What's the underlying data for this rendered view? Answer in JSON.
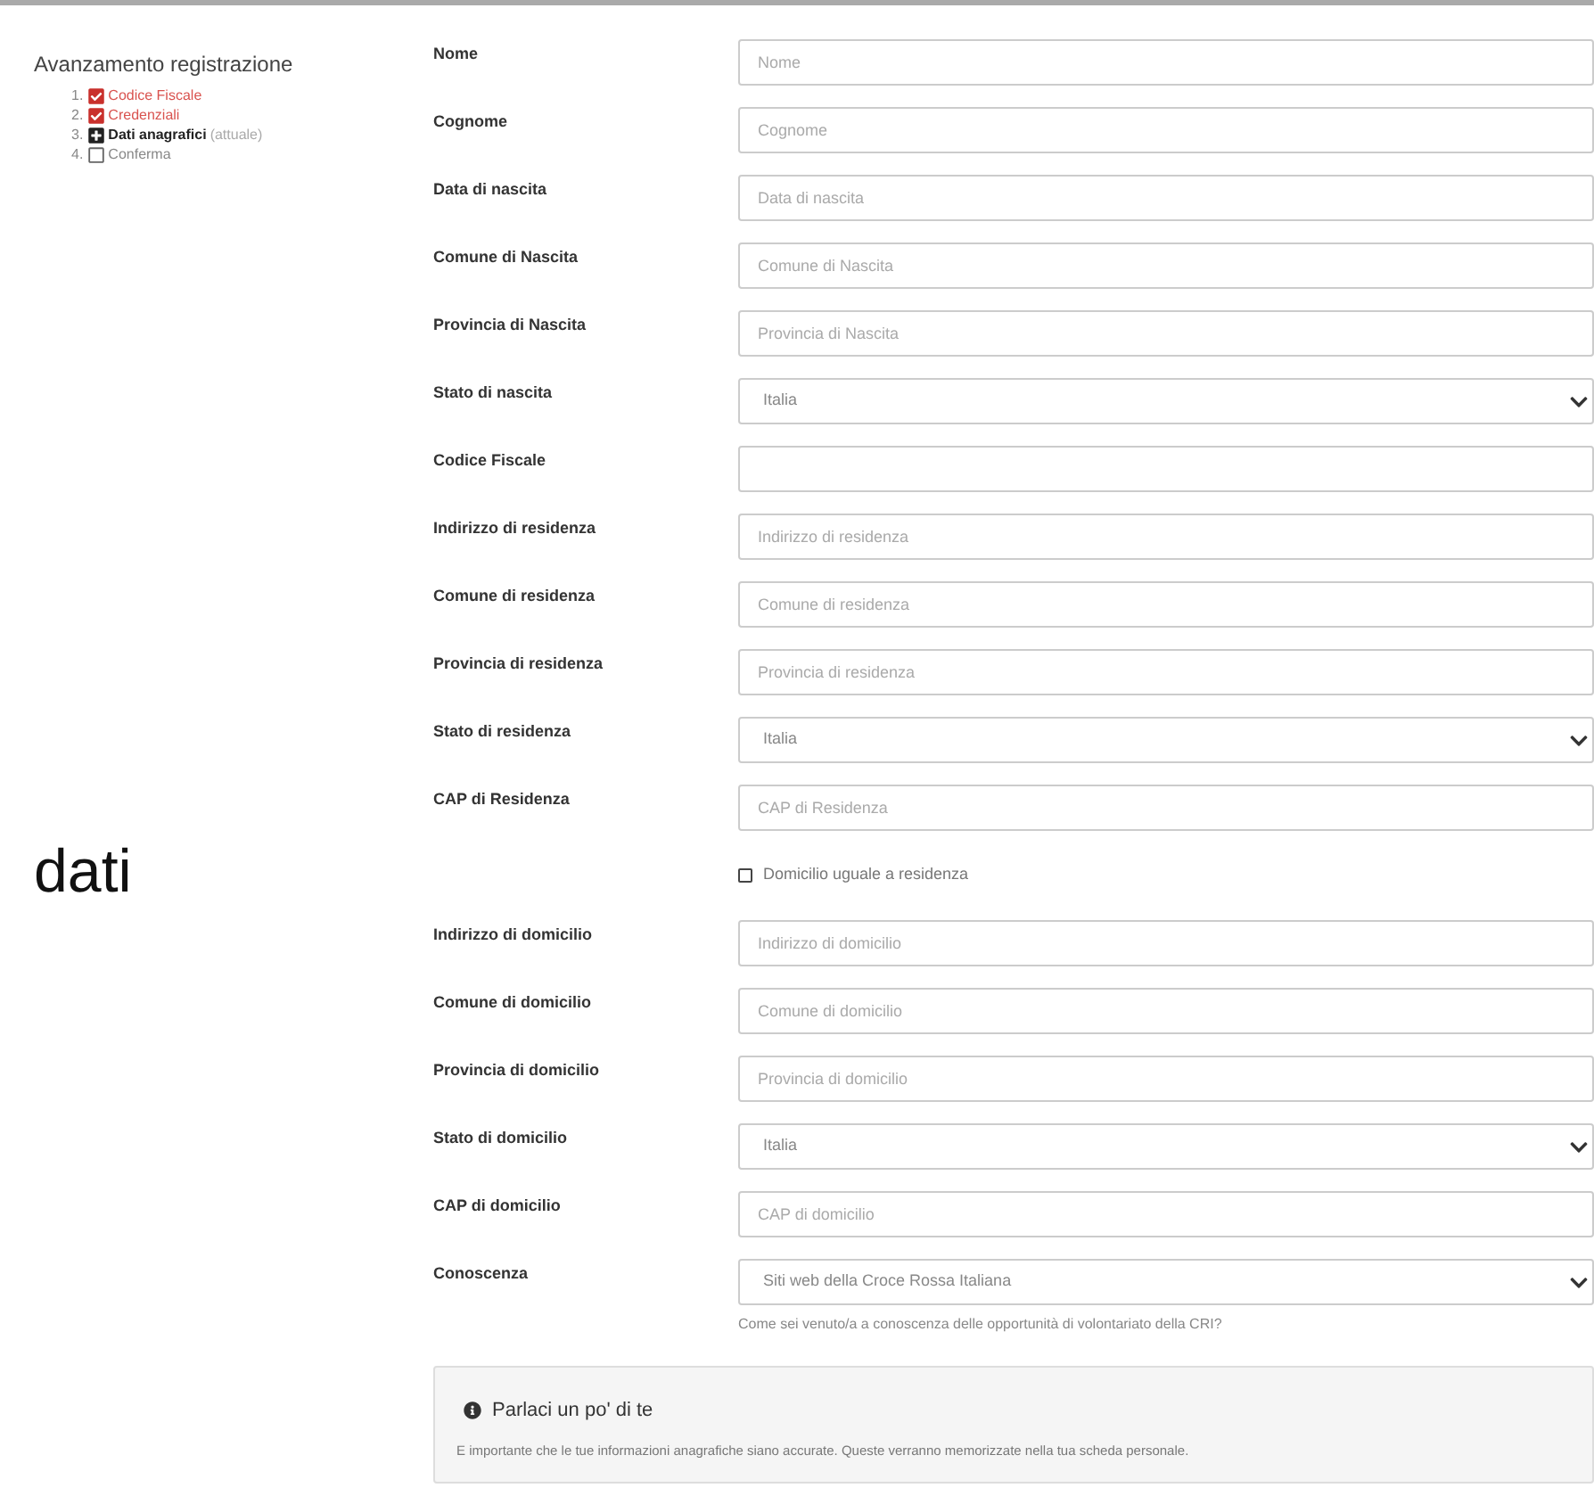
{
  "progress": {
    "title": "Avanzamento registrazione",
    "steps": [
      {
        "number": "1.",
        "label": "Codice Fiscale",
        "kind": "done"
      },
      {
        "number": "2.",
        "label": "Credenziali",
        "kind": "done"
      },
      {
        "number": "3.",
        "label": "Dati anagrafici",
        "note": "(attuale)",
        "kind": "current"
      },
      {
        "number": "4.",
        "label": "Conferma",
        "kind": "todo"
      }
    ]
  },
  "side_caption": "dati",
  "form": {
    "fields": [
      {
        "label": "Nome",
        "kind": "text",
        "placeholder": "Nome"
      },
      {
        "label": "Cognome",
        "kind": "text",
        "placeholder": "Cognome"
      },
      {
        "label": "Data di nascita",
        "kind": "text",
        "placeholder": "Data di nascita"
      },
      {
        "label": "Comune di Nascita",
        "kind": "text",
        "placeholder": "Comune di Nascita"
      },
      {
        "label": "Provincia di Nascita",
        "kind": "text",
        "placeholder": "Provincia di Nascita"
      },
      {
        "label": "Stato di nascita",
        "kind": "select",
        "value": "Italia"
      },
      {
        "label": "Codice Fiscale",
        "kind": "text"
      },
      {
        "label": "Indirizzo di residenza",
        "kind": "text",
        "placeholder": "Indirizzo di residenza"
      },
      {
        "label": "Comune di residenza",
        "kind": "text",
        "placeholder": "Comune di residenza"
      },
      {
        "label": "Provincia di residenza",
        "kind": "text",
        "placeholder": "Provincia di residenza"
      },
      {
        "label": "Stato di residenza",
        "kind": "select",
        "value": "Italia"
      },
      {
        "label": "CAP di Residenza",
        "kind": "text",
        "placeholder": "CAP di Residenza"
      },
      {
        "label": "Domicilio uguale a residenza",
        "kind": "checkbox",
        "checked": false
      },
      {
        "label": "Indirizzo di domicilio",
        "kind": "text",
        "placeholder": "Indirizzo di domicilio"
      },
      {
        "label": "Comune di domicilio",
        "kind": "text",
        "placeholder": "Comune di domicilio"
      },
      {
        "label": "Provincia di domicilio",
        "kind": "text",
        "placeholder": "Provincia di domicilio"
      },
      {
        "label": "Stato di domicilio",
        "kind": "select",
        "value": "Italia"
      },
      {
        "label": "CAP di domicilio",
        "kind": "text",
        "placeholder": "CAP di domicilio"
      },
      {
        "label": "Conoscenza",
        "kind": "select",
        "value": "Siti web della Croce Rossa Italiana",
        "help": "Come sei venuto/a a conoscenza delle opportunità di volontariato della CRI?"
      }
    ]
  },
  "info_panel": {
    "title": "Parlaci un po' di te",
    "text": "E importante che le tue informazioni anagrafiche siano accurate. Queste verranno memorizzate nella tua scheda personale."
  }
}
